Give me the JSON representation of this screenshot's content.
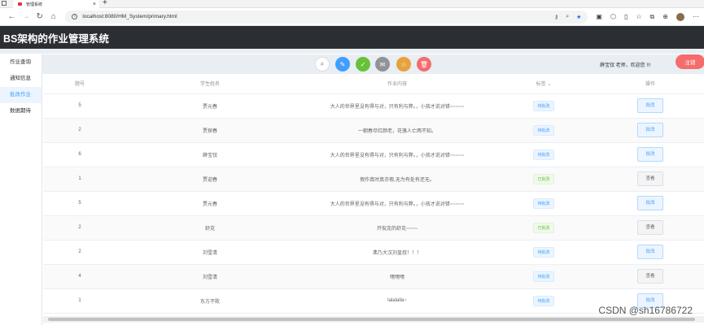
{
  "browser": {
    "tab_title": "管理系统",
    "tab_close": "×",
    "new_tab": "+",
    "url": "localhost:8080/HM_System/primary.html"
  },
  "app": {
    "title": "BS架构的作业管理系统"
  },
  "sidebar": {
    "items": [
      {
        "label": "作业查询"
      },
      {
        "label": "通知信息"
      },
      {
        "label": "批改作业"
      },
      {
        "label": "数据期待"
      }
    ]
  },
  "toolbar": {
    "user_text": "薛宝钗 老师，欢迎您 !!!",
    "logout_label": "注销"
  },
  "table": {
    "headers": [
      "题号",
      "学生姓名",
      "作业内容",
      "标签",
      "操作"
    ],
    "rows": [
      {
        "num": "5",
        "student": "贾元春",
        "content": "大人的世界里没有得与对，只有利与弊。，小孩才说对错~~~~~",
        "tag": "待批改",
        "status": "pending",
        "action": "批改"
      },
      {
        "num": "2",
        "student": "贾探春",
        "content": "一朝春尽红颜老，花落人亡两不知。",
        "tag": "待批改",
        "status": "pending",
        "action": "批改"
      },
      {
        "num": "6",
        "student": "薛宝钗",
        "content": "大人的世界里没有得与对，只有利与弊。，小孩才说对错~~~~~",
        "tag": "待批改",
        "status": "pending",
        "action": "批改"
      },
      {
        "num": "1",
        "student": "贾迎春",
        "content": "假作真时真亦假,无为有处有还无。",
        "tag": "已批改",
        "status": "done",
        "action": "查看"
      },
      {
        "num": "5",
        "student": "贾元春",
        "content": "大人的世界里没有得与对，只有利与弊。，小孩才说对错~~~~~",
        "tag": "待批改",
        "status": "pending",
        "action": "批改"
      },
      {
        "num": "2",
        "student": "舒克",
        "content": "开侃克的舒克~~~~",
        "tag": "已批改",
        "status": "done",
        "action": "查看"
      },
      {
        "num": "2",
        "student": "刘雪清",
        "content": "弗乃大汉刘皇叔！！！",
        "tag": "待批改",
        "status": "pending",
        "action": "批改"
      },
      {
        "num": "4",
        "student": "刘雪清",
        "content": "嘿嘿嘿",
        "tag": "待批改",
        "status": "pending",
        "action": "查看"
      },
      {
        "num": "1",
        "student": "东方不败",
        "content": "lalalalla~",
        "tag": "待批改",
        "status": "pending",
        "action": "批改"
      }
    ]
  },
  "watermark": "CSDN @sh16786722"
}
